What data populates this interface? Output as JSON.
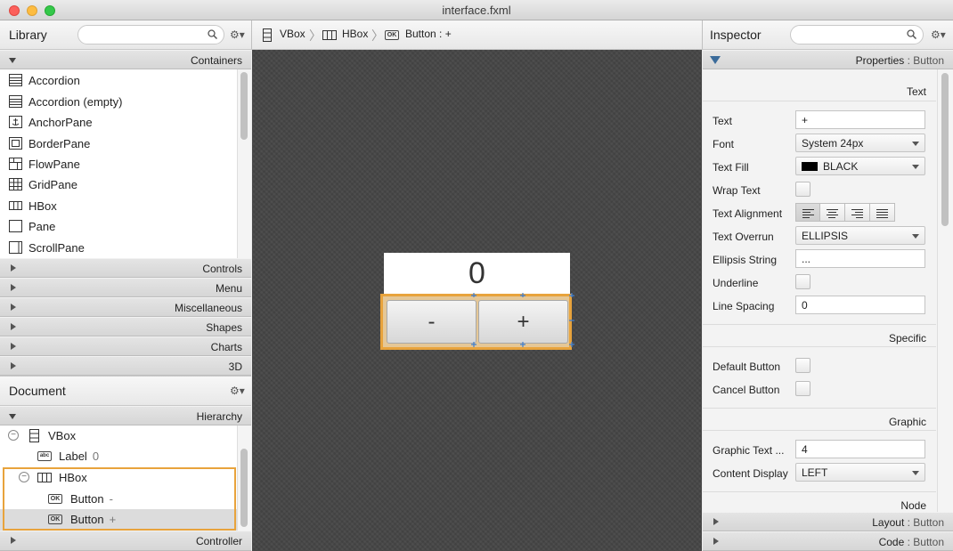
{
  "window": {
    "title": "interface.fxml"
  },
  "library": {
    "title": "Library",
    "search_placeholder": "",
    "containers_label": "Containers",
    "items": [
      {
        "label": "Accordion",
        "icon": "accordion-icon"
      },
      {
        "label": "Accordion  (empty)",
        "icon": "accordion-icon"
      },
      {
        "label": "AnchorPane",
        "icon": "anchor-icon"
      },
      {
        "label": "BorderPane",
        "icon": "borderpane-icon"
      },
      {
        "label": "FlowPane",
        "icon": "flowpane-icon"
      },
      {
        "label": "GridPane",
        "icon": "gridpane-icon"
      },
      {
        "label": "HBox",
        "icon": "hbox-icon"
      },
      {
        "label": "Pane",
        "icon": "pane-icon"
      },
      {
        "label": "ScrollPane",
        "icon": "scrollpane-icon"
      }
    ],
    "sections": [
      "Controls",
      "Menu",
      "Miscellaneous",
      "Shapes",
      "Charts",
      "3D"
    ]
  },
  "document": {
    "title": "Document",
    "hierarchy_label": "Hierarchy",
    "controller_label": "Controller",
    "tree": [
      {
        "type": "VBox",
        "sub": ""
      },
      {
        "type": "Label",
        "sub": "0"
      },
      {
        "type": "HBox",
        "sub": ""
      },
      {
        "type": "Button",
        "sub": "-"
      },
      {
        "type": "Button",
        "sub": "+"
      }
    ]
  },
  "breadcrumb": [
    {
      "label": "VBox",
      "icon": "vbox-icon"
    },
    {
      "label": "HBox",
      "icon": "hbox-icon"
    },
    {
      "label": "Button : +",
      "icon": "button-icon"
    }
  ],
  "preview": {
    "label_text": "0",
    "minus_text": "-",
    "plus_text": "+"
  },
  "inspector": {
    "title": "Inspector",
    "properties_label": "Properties",
    "properties_target": ": Button",
    "sections": {
      "text": "Text",
      "specific": "Specific",
      "graphic": "Graphic",
      "node": "Node"
    },
    "labels": {
      "text": "Text",
      "font": "Font",
      "text_fill": "Text Fill",
      "wrap_text": "Wrap Text",
      "text_alignment": "Text Alignment",
      "text_overrun": "Text Overrun",
      "ellipsis_string": "Ellipsis String",
      "underline": "Underline",
      "line_spacing": "Line Spacing",
      "default_button": "Default Button",
      "cancel_button": "Cancel Button",
      "graphic_text_gap": "Graphic Text ...",
      "content_display": "Content Display"
    },
    "values": {
      "text": "+",
      "font": "System 24px",
      "text_fill": "BLACK",
      "text_fill_color": "#000000",
      "text_overrun": "ELLIPSIS",
      "ellipsis_string": "...",
      "line_spacing": "0",
      "graphic_text_gap": "4",
      "content_display": "LEFT"
    },
    "layout_label": "Layout",
    "layout_target": ": Button",
    "code_label": "Code",
    "code_target": ": Button"
  },
  "colors": {
    "selection": "#e8a33c",
    "handles": "#3f7fd1"
  }
}
